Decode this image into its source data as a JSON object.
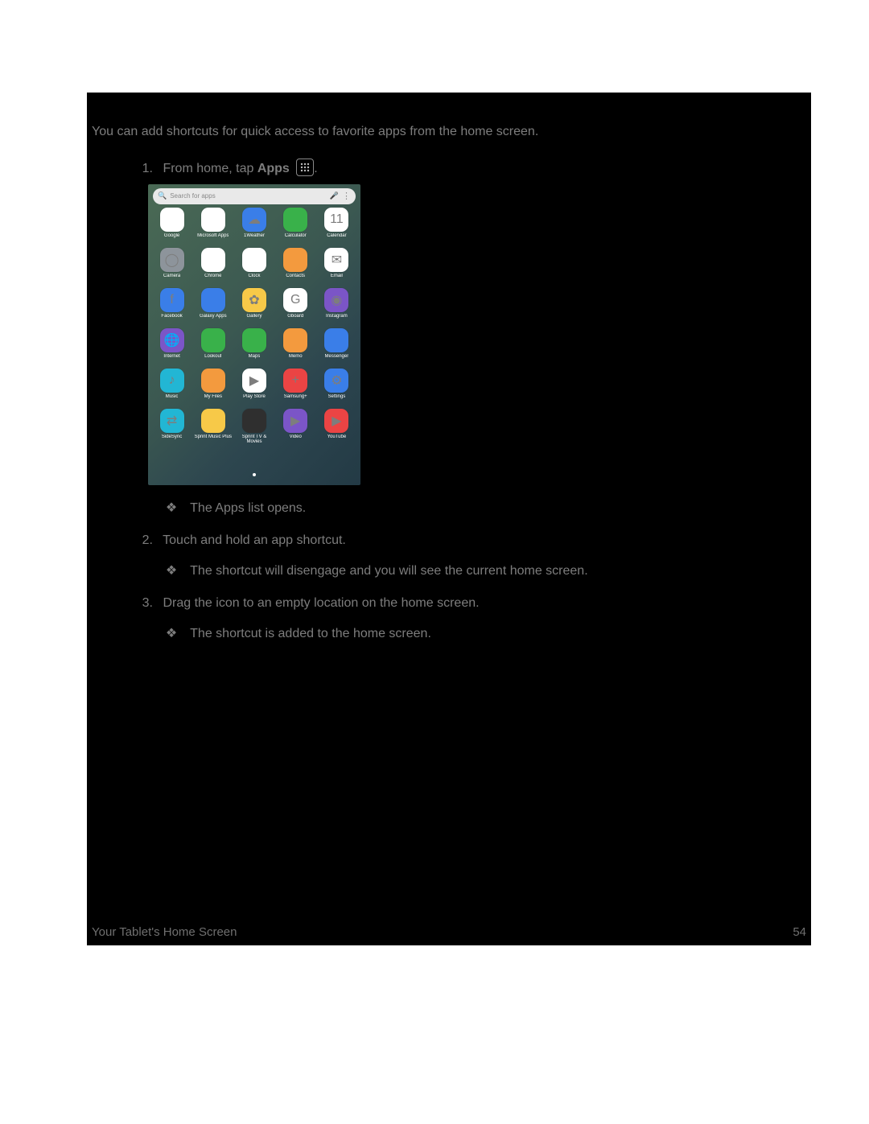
{
  "intro": "You can add shortcuts for quick access to favorite apps from the home screen.",
  "steps": {
    "s1_num": "1.",
    "s1_pre": "From home, tap ",
    "s1_bold": "Apps",
    "s1_post": ".",
    "s2_num": "2.",
    "s2_text": "Touch and hold an app shortcut.",
    "s3_num": "3.",
    "s3_text": "Drag the icon to an empty location on the home screen."
  },
  "subs": {
    "diamond": "❖",
    "a": "The Apps list opens.",
    "b": "The shortcut will disengage and you will see the current home screen.",
    "c": "The shortcut is added to the home screen."
  },
  "search": {
    "placeholder": "Search for apps"
  },
  "apps": [
    {
      "label": "Google",
      "bg": "bg-white",
      "glyph": ""
    },
    {
      "label": "Microsoft Apps",
      "bg": "bg-white",
      "glyph": ""
    },
    {
      "label": "1Weather",
      "bg": "bg-blue",
      "glyph": "☁"
    },
    {
      "label": "Calculator",
      "bg": "bg-green",
      "glyph": ""
    },
    {
      "label": "Calendar",
      "bg": "bg-white",
      "glyph": "11"
    },
    {
      "label": "Camera",
      "bg": "bg-grey",
      "glyph": "◯"
    },
    {
      "label": "Chrome",
      "bg": "bg-white",
      "glyph": ""
    },
    {
      "label": "Clock",
      "bg": "bg-white",
      "glyph": ""
    },
    {
      "label": "Contacts",
      "bg": "bg-orange",
      "glyph": ""
    },
    {
      "label": "Email",
      "bg": "bg-white",
      "glyph": "✉"
    },
    {
      "label": "Facebook",
      "bg": "bg-blue",
      "glyph": "f"
    },
    {
      "label": "Galaxy Apps",
      "bg": "bg-blue",
      "glyph": ""
    },
    {
      "label": "Gallery",
      "bg": "bg-yellow",
      "glyph": "✿"
    },
    {
      "label": "Gboard",
      "bg": "bg-white",
      "glyph": "G"
    },
    {
      "label": "Instagram",
      "bg": "bg-purple",
      "glyph": "◉"
    },
    {
      "label": "Internet",
      "bg": "bg-purple",
      "glyph": "🌐"
    },
    {
      "label": "Lookout",
      "bg": "bg-green",
      "glyph": ""
    },
    {
      "label": "Maps",
      "bg": "bg-green",
      "glyph": ""
    },
    {
      "label": "Memo",
      "bg": "bg-orange",
      "glyph": ""
    },
    {
      "label": "Messenger",
      "bg": "bg-blue",
      "glyph": ""
    },
    {
      "label": "Music",
      "bg": "bg-teal",
      "glyph": "♪"
    },
    {
      "label": "My Files",
      "bg": "bg-orange",
      "glyph": ""
    },
    {
      "label": "Play Store",
      "bg": "bg-white",
      "glyph": "▶"
    },
    {
      "label": "Samsung+",
      "bg": "bg-red",
      "glyph": "+"
    },
    {
      "label": "Settings",
      "bg": "bg-blue",
      "glyph": "⚙"
    },
    {
      "label": "SideSync",
      "bg": "bg-teal",
      "glyph": "⇄"
    },
    {
      "label": "Sprint Music Plus",
      "bg": "bg-yellow",
      "glyph": ""
    },
    {
      "label": "Sprint TV & Movies",
      "bg": "bg-dark",
      "glyph": ""
    },
    {
      "label": "Video",
      "bg": "bg-purple",
      "glyph": "▶"
    },
    {
      "label": "YouTube",
      "bg": "bg-red",
      "glyph": "▶"
    }
  ],
  "footer": {
    "section": "Your Tablet's Home Screen",
    "page": "54"
  }
}
